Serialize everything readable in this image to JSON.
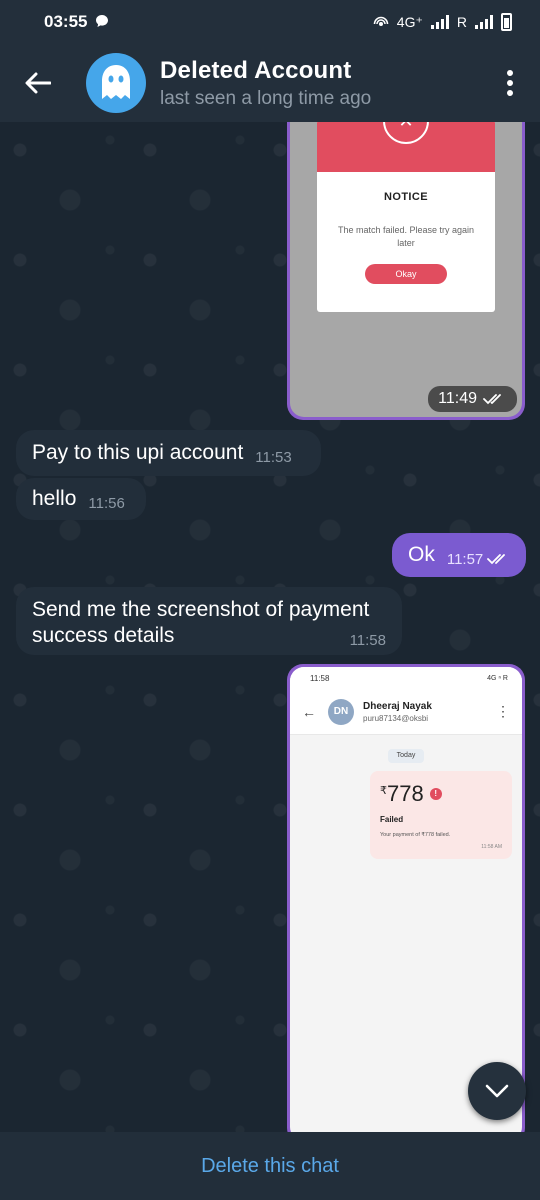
{
  "status_bar": {
    "time": "03:55",
    "network_label": "4G⁺",
    "roaming_label": "R"
  },
  "header": {
    "title": "Deleted Account",
    "subtitle": "last seen a long time ago"
  },
  "messages": {
    "image1": {
      "notice_title": "NOTICE",
      "notice_message": "The match failed. Please try again later",
      "notice_button": "Okay",
      "time": "11:49"
    },
    "msg1": {
      "text": "Pay to this upi account",
      "time": "11:53"
    },
    "msg2": {
      "text": "hello",
      "time": "11:56"
    },
    "msg3": {
      "text": "Ok",
      "time": "11:57"
    },
    "msg4": {
      "text": "Send me the screenshot of payment success details",
      "time": "11:58"
    },
    "image2": {
      "status_time": "11:58",
      "status_right": "4G ⁿ R",
      "avatar_initials": "DN",
      "contact_name": "Dheeraj Nayak",
      "contact_handle": "puru87134@oksbi",
      "date_chip": "Today",
      "currency": "₹",
      "amount": "778",
      "status": "Failed",
      "description": "Your payment of ₹778 failed.",
      "timestamp": "11:58 AM"
    }
  },
  "bottom_bar": {
    "delete_label": "Delete this chat"
  },
  "colors": {
    "header_bg": "#232f3b",
    "incoming_bubble": "#222e3a",
    "outgoing_bubble": "#7b5bd0",
    "link_blue": "#5aa8e8",
    "avatar_blue": "#45a6ea"
  }
}
